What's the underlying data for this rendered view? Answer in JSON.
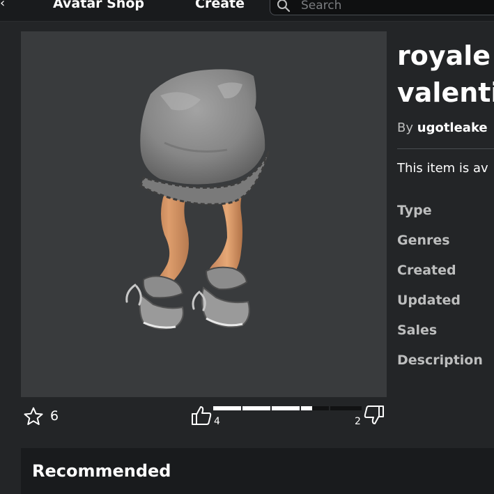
{
  "header": {
    "edge_glyph": "‹",
    "nav": [
      "Avatar Shop",
      "Create"
    ],
    "search": {
      "placeholder": "Search",
      "value": ""
    }
  },
  "item": {
    "title_line1": "royale",
    "title_line2": "valenti",
    "by_label": "By",
    "creator": "ugotleake",
    "description_snippet": "This item is av",
    "detail_labels": [
      "Type",
      "Genres",
      "Created",
      "Updated",
      "Sales",
      "Description"
    ]
  },
  "stats": {
    "favorites": "6",
    "upvotes": "4",
    "downvotes": "2",
    "upvote_ratio": 0.667
  },
  "sections": {
    "recommended": "Recommended"
  },
  "icons": {
    "search": "search-icon",
    "favorite": "star-outline-icon",
    "upvote": "thumbs-up-icon",
    "downvote": "thumbs-down-icon"
  },
  "colors": {
    "page_bg": "#232527",
    "header_bg": "#191b1d",
    "thumbnail_bg": "#393b3d",
    "muted_text": "#bdbebe",
    "vote_fill": "#ffffff"
  }
}
